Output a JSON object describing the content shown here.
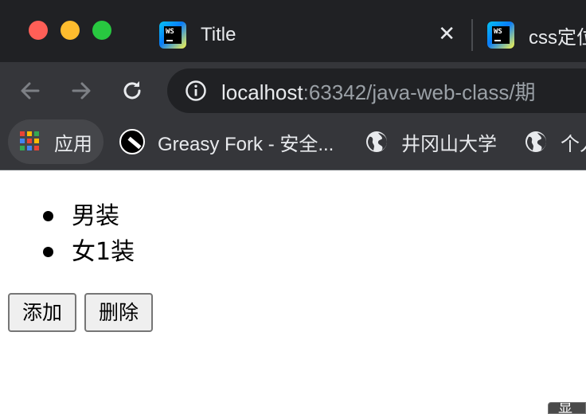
{
  "window": {
    "traffic_colors": {
      "close": "#ff5f57",
      "minimize": "#febc2e",
      "maximize": "#28c840"
    }
  },
  "tabs": [
    {
      "title": "Title",
      "icon": "webstorm-icon",
      "close": "✕"
    },
    {
      "title": "css定位",
      "icon": "webstorm-icon"
    }
  ],
  "toolbar": {
    "url_host": "localhost",
    "url_rest": ":63342/java-web-class/期",
    "icons": [
      "back-arrow-icon",
      "forward-arrow-icon",
      "reload-icon",
      "info-icon"
    ]
  },
  "bookmarks": [
    {
      "label": "应用",
      "icon": "apps-grid-icon"
    },
    {
      "label": "Greasy Fork - 安全...",
      "icon": "greasy-fork-icon"
    },
    {
      "label": "井冈山大学",
      "icon": "globe-icon"
    },
    {
      "label": "个人",
      "icon": "globe-icon"
    }
  ],
  "page": {
    "list_items": [
      "男装",
      "女1装"
    ],
    "buttons": {
      "add": "添加",
      "delete": "删除"
    },
    "corner_text": "显示"
  },
  "colors": {
    "tab_strip_bg": "#202124",
    "toolbar_bg": "#35363a",
    "omnibox_bg": "#202124",
    "text_light": "#e8eaed",
    "text_muted": "#9aa0a6",
    "page_bg": "#ffffff"
  }
}
